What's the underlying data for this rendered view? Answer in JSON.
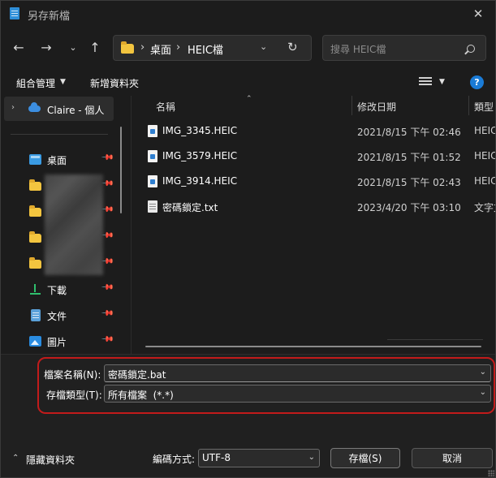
{
  "window": {
    "title": "另存新檔",
    "close_glyph": "✕"
  },
  "nav": {
    "back_glyph": "←",
    "forward_glyph": "→",
    "recent_glyph": "⌄",
    "up_glyph": "↑",
    "address_segments": [
      "桌面",
      "HEIC檔"
    ],
    "address_sep_glyph": "›",
    "address_dropdown_glyph": "⌄",
    "refresh_glyph": "↻",
    "search_placeholder": "搜尋 HEIC檔"
  },
  "toolbar": {
    "organize_label": "組合管理",
    "organize_caret": "▼",
    "new_folder_label": "新增資料夾",
    "view_caret": "▼",
    "help_glyph": "?"
  },
  "sidebar": {
    "onedrive_chevron": "›",
    "onedrive_label": "Claire - 個人",
    "pin_glyph": "📌",
    "items": [
      {
        "label": "桌面",
        "icon": "desktop-icon"
      },
      {
        "label": "",
        "icon": "folder-icon"
      },
      {
        "label": "",
        "icon": "folder-icon"
      },
      {
        "label": "",
        "icon": "folder-icon"
      },
      {
        "label": "",
        "icon": "folder-icon"
      },
      {
        "label": "下載",
        "icon": "download-icon"
      },
      {
        "label": "文件",
        "icon": "documents-icon"
      },
      {
        "label": "圖片",
        "icon": "pictures-icon"
      }
    ]
  },
  "filelist": {
    "columns": {
      "name": "名稱",
      "date": "修改日期",
      "type": "類型"
    },
    "sort_arrow": "⌃",
    "files": [
      {
        "name": "IMG_3345.HEIC",
        "date": "2021/8/15 下午 02:46",
        "type": "HEIC",
        "icon": "heic-file-icon"
      },
      {
        "name": "IMG_3579.HEIC",
        "date": "2021/8/15 下午 01:52",
        "type": "HEIC",
        "icon": "heic-file-icon"
      },
      {
        "name": "IMG_3914.HEIC",
        "date": "2021/8/15 下午 02:43",
        "type": "HEIC",
        "icon": "heic-file-icon"
      },
      {
        "name": "密碼鎖定.txt",
        "date": "2023/4/20 下午 03:10",
        "type": "文字文件",
        "icon": "text-file-icon"
      }
    ]
  },
  "save": {
    "filename_label": "檔案名稱(N):",
    "filename_value": "密碼鎖定.bat",
    "filetype_label": "存檔類型(T):",
    "filetype_value": "所有檔案  (*.*)",
    "combo_caret": "⌄",
    "hide_folders_caret": "⌃",
    "hide_folders_label": "隱藏資料夾",
    "encoding_label": "編碼方式:",
    "encoding_value": "UTF-8",
    "save_button": "存檔(S)",
    "cancel_button": "取消"
  },
  "colors": {
    "background": "#1c1c1c",
    "highlight": "#c21b1b",
    "accent": "#1a7bd6"
  }
}
